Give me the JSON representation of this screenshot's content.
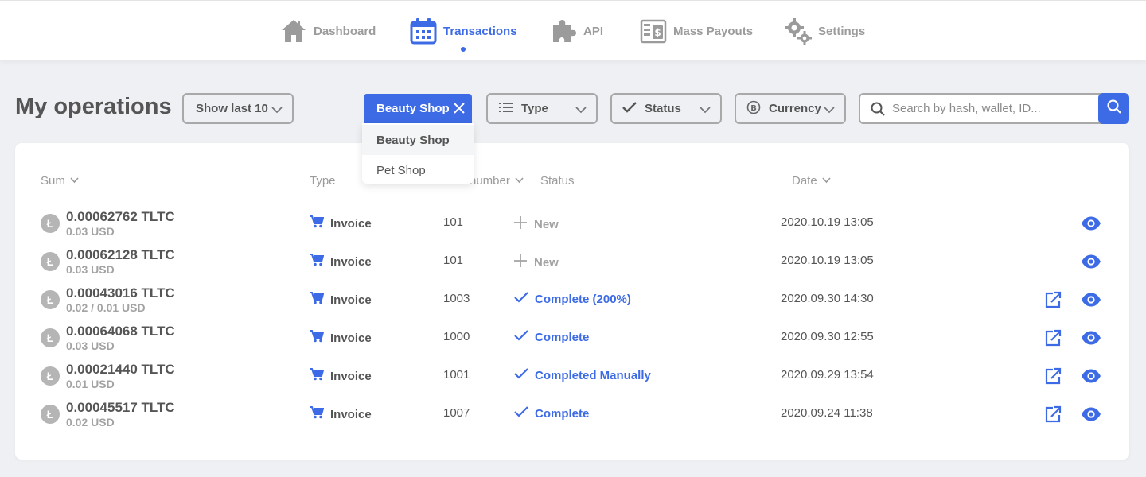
{
  "nav": {
    "items": [
      {
        "label": "Dashboard",
        "icon": "home-icon"
      },
      {
        "label": "Transactions",
        "icon": "calendar-icon",
        "active": true
      },
      {
        "label": "API",
        "icon": "puzzle-icon"
      },
      {
        "label": "Mass Payouts",
        "icon": "cash-register-icon"
      },
      {
        "label": "Settings",
        "icon": "gears-icon"
      }
    ]
  },
  "toolbar": {
    "title": "My operations",
    "show_last": "Show last 10",
    "shop_chip": "Beauty Shop",
    "type_label": "Type",
    "status_label": "Status",
    "currency_label": "Currency",
    "search_placeholder": "Search by hash, wallet, ID..."
  },
  "shop_dropdown": {
    "options": [
      "Beauty Shop",
      "Pet Shop"
    ],
    "selected": "Beauty Shop"
  },
  "table": {
    "columns": {
      "sum": "Sum",
      "type": "Type",
      "number": "number",
      "status": "Status",
      "date": "Date"
    },
    "rows": [
      {
        "sum": "0.00062762 TLTC",
        "usd": "0.03 USD",
        "type": "Invoice",
        "number": "101",
        "status": "New",
        "status_kind": "new",
        "date": "2020.10.19 13:05",
        "has_link": false
      },
      {
        "sum": "0.00062128 TLTC",
        "usd": "0.03 USD",
        "type": "Invoice",
        "number": "101",
        "status": "New",
        "status_kind": "new",
        "date": "2020.10.19 13:05",
        "has_link": false
      },
      {
        "sum": "0.00043016 TLTC",
        "usd": "0.02 / 0.01 USD",
        "type": "Invoice",
        "number": "1003",
        "status": "Complete (200%)",
        "status_kind": "complete",
        "date": "2020.09.30 14:30",
        "has_link": true
      },
      {
        "sum": "0.00064068 TLTC",
        "usd": "0.03 USD",
        "type": "Invoice",
        "number": "1000",
        "status": "Complete",
        "status_kind": "complete",
        "date": "2020.09.30 12:55",
        "has_link": true
      },
      {
        "sum": "0.00021440 TLTC",
        "usd": "0.01 USD",
        "type": "Invoice",
        "number": "1001",
        "status": "Completed Manually",
        "status_kind": "complete",
        "date": "2020.09.29 13:54",
        "has_link": true
      },
      {
        "sum": "0.00045517 TLTC",
        "usd": "0.02 USD",
        "type": "Invoice",
        "number": "1007",
        "status": "Complete",
        "status_kind": "complete",
        "date": "2020.09.24 11:38",
        "has_link": true
      }
    ]
  },
  "colors": {
    "accent": "#3d6be5",
    "muted": "#9b9b9b",
    "text": "#555555",
    "background": "#eef0f3"
  }
}
